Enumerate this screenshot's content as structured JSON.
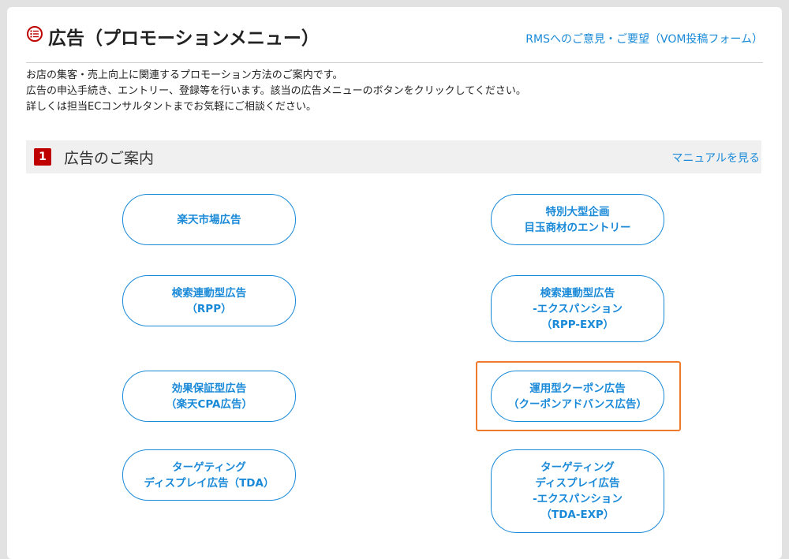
{
  "header": {
    "title": "広告（プロモーションメニュー）",
    "feedback_link": "RMSへのご意見・ご要望（VOM投稿フォーム）",
    "icon": "list-circle-icon"
  },
  "intro": [
    "お店の集客・売上向上に関連するプロモーション方法のご案内です。",
    "広告の申込手続き、エントリー、登録等を行います。該当の広告メニューのボタンをクリックしてください。",
    "詳しくは担当ECコンサルタントまでお気軽にご相談ください。"
  ],
  "section": {
    "number": "1",
    "title": "広告のご案内",
    "manual_link": "マニュアルを見る"
  },
  "buttons": [
    {
      "lines": [
        "楽天市場広告"
      ]
    },
    {
      "lines": [
        "特別大型企画",
        "目玉商材のエントリー"
      ]
    },
    {
      "lines": [
        "検索連動型広告",
        "（RPP）"
      ]
    },
    {
      "lines": [
        "検索連動型広告",
        "-エクスパンション",
        "（RPP-EXP）"
      ]
    },
    {
      "lines": [
        "効果保証型広告",
        "（楽天CPA広告）"
      ]
    },
    {
      "lines": [
        "運用型クーポン広告",
        "（クーポンアドバンス広告）"
      ]
    },
    {
      "lines": [
        "ターゲティング",
        "ディスプレイ広告（TDA）"
      ]
    },
    {
      "lines": [
        "ターゲティング",
        "ディスプレイ広告",
        "-エクスパンション",
        "（TDA-EXP）"
      ]
    }
  ],
  "colors": {
    "brand": "#bf0000",
    "link": "#1a8ad8",
    "highlight": "#ef7a2e"
  }
}
